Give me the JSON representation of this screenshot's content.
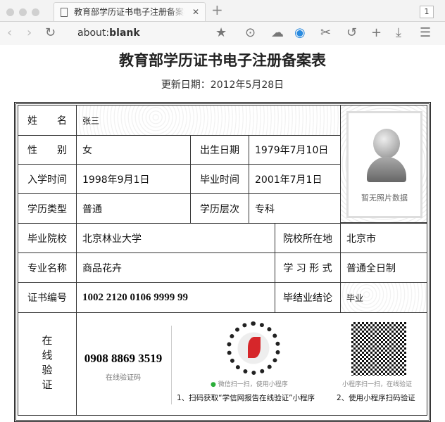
{
  "browser": {
    "tab_title": "教育部学历证书电子注册备案表",
    "tab_count": "1",
    "url_prefix": "about:",
    "url_bold": "blank"
  },
  "document": {
    "title": "教育部学历证书电子注册备案表",
    "update_date": "更新日期：2012年5月28日",
    "fields": {
      "name_label": "姓　　名",
      "name": "张三",
      "gender_label": "性　　别",
      "gender": "女",
      "birth_label": "出生日期",
      "birth": "1979年7月10日",
      "enroll_label": "入学时间",
      "enroll": "1998年9月1日",
      "grad_label": "毕业时间",
      "grad": "2001年7月1日",
      "type_label": "学历类型",
      "type": "普通",
      "level_label": "学历层次",
      "level": "专科",
      "school_label": "毕业院校",
      "school": "北京林业大学",
      "loc_label": "院校所在地",
      "loc": "北京市",
      "major_label": "专业名称",
      "major": "商品花卉",
      "mode_label": "学 习 形 式",
      "mode": "普通全日制",
      "cert_label": "证书编号",
      "cert": "1002 2120 0106 9999 99",
      "result_label": "毕结业结论",
      "result": "毕业"
    },
    "photo_placeholder": "暂无照片数据",
    "verify": {
      "label": "在线验证",
      "code": "0908 8869 3519",
      "code_label": "在线验证码",
      "wechat_hint": "微信扫一扫，使用小程序",
      "qr_hint": "小程序扫一扫，在线验证",
      "step1": "1、扫码获取“学信网报告在线验证”小程序",
      "step2": "2、使用小程序扫码验证"
    }
  }
}
